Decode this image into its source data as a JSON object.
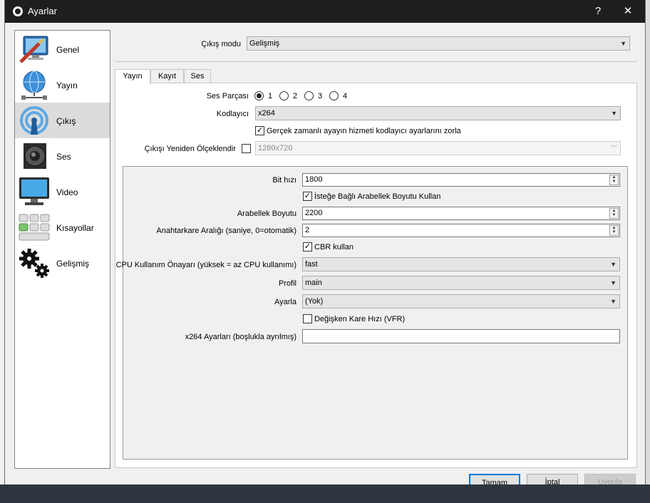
{
  "window": {
    "title": "Ayarlar",
    "help_label": "?",
    "close_label": "✕"
  },
  "sidebar": {
    "items": [
      {
        "label": "Genel",
        "icon": "monitor-brush-icon"
      },
      {
        "label": "Yayın",
        "icon": "globe-network-icon"
      },
      {
        "label": "Çıkış",
        "icon": "broadcast-icon"
      },
      {
        "label": "Ses",
        "icon": "speaker-icon"
      },
      {
        "label": "Video",
        "icon": "display-icon"
      },
      {
        "label": "Kısayollar",
        "icon": "keyboard-icon"
      },
      {
        "label": "Gelişmiş",
        "icon": "gears-icon"
      }
    ],
    "selected": "Çıkış"
  },
  "output_mode": {
    "label": "Çıkış modu",
    "value": "Gelişmiş"
  },
  "tabs": [
    {
      "label": "Yayın"
    },
    {
      "label": "Kayıt"
    },
    {
      "label": "Ses"
    }
  ],
  "active_tab": "Yayın",
  "stream": {
    "audio_track": {
      "label": "Ses Parçası",
      "options": [
        "1",
        "2",
        "3",
        "4"
      ],
      "selected": "1"
    },
    "encoder": {
      "label": "Kodlayıcı",
      "value": "x264"
    },
    "enforce": {
      "label": "Gerçek zamanlı ayayın hizmeti kodlayıcı ayarlarını zorla",
      "checked": true
    },
    "rescale": {
      "label": "Çıkışı Yeniden Ölçeklendir",
      "checked": false,
      "value": "1280x720"
    }
  },
  "encoder_settings": {
    "bitrate": {
      "label": "Bit hızı",
      "value": "1800"
    },
    "custom_buffer": {
      "label": "İsteğe Bağlı Arabellek Boyutu Kullan",
      "checked": true
    },
    "buffer_size": {
      "label": "Arabellek Boyutu",
      "value": "2200"
    },
    "keyframe": {
      "label": "Anahtarkare Aralığı (saniye, 0=otomatik)",
      "value": "2"
    },
    "cbr": {
      "label": "CBR kullan",
      "checked": true
    },
    "cpu_preset": {
      "label": "CPU Kullanım Önayarı (yüksek = az CPU kullanımı)",
      "value": "fast"
    },
    "profile": {
      "label": "Profil",
      "value": "main"
    },
    "tune": {
      "label": "Ayarla",
      "value": "(Yok)"
    },
    "vfr": {
      "label": "Değişken Kare Hızı (VFR)",
      "checked": false
    },
    "x264opts": {
      "label": "x264 Ayarları (boşlukla ayrılmış)",
      "value": ""
    }
  },
  "buttons": {
    "ok": "Tamam",
    "cancel": "İptal",
    "apply": "Uygula"
  }
}
